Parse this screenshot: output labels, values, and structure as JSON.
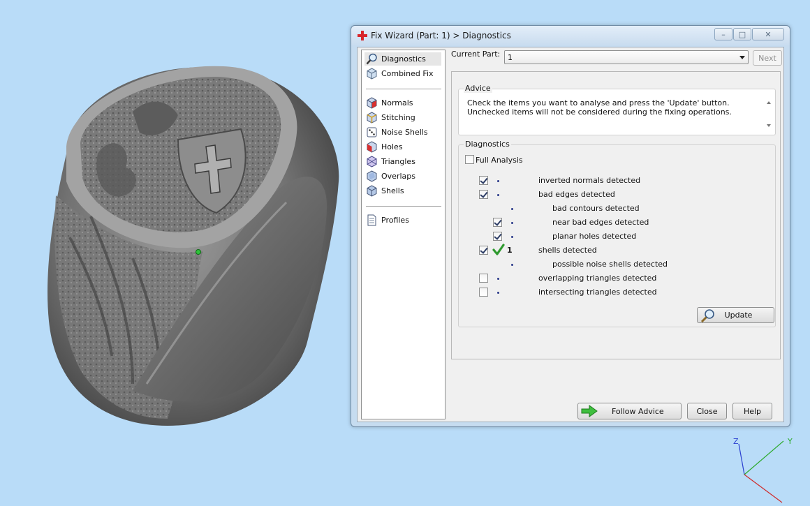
{
  "window": {
    "title": "Fix Wizard (Part: 1) > Diagnostics",
    "minimize_glyph": "–",
    "maximize_glyph": "□",
    "close_glyph": "✕"
  },
  "nav": {
    "top_items": [
      {
        "label": "Diagnostics",
        "icon": "magnifier-icon",
        "selected": true
      },
      {
        "label": "Combined Fix",
        "icon": "cube-icon"
      }
    ],
    "fix_items": [
      {
        "label": "Normals",
        "icon": "cube-red-face-icon"
      },
      {
        "label": "Stitching",
        "icon": "cube-stitch-icon"
      },
      {
        "label": "Noise Shells",
        "icon": "dice-icon"
      },
      {
        "label": "Holes",
        "icon": "cube-hole-icon"
      },
      {
        "label": "Triangles",
        "icon": "triangle-cube-icon"
      },
      {
        "label": "Overlaps",
        "icon": "overlap-cube-icon"
      },
      {
        "label": "Shells",
        "icon": "shells-cube-icon"
      }
    ],
    "profile_items": [
      {
        "label": "Profiles",
        "icon": "document-icon"
      }
    ]
  },
  "top_row": {
    "current_part_label": "Current Part:",
    "current_part_value": "1",
    "next_label": "Next"
  },
  "advice": {
    "title": "Advice",
    "text": "Check the items you want to analyse and press the 'Update' button. Unchecked items will not be considered during the fixing operations."
  },
  "diagnostics": {
    "title": "Diagnostics",
    "full_analysis_label": "Full Analysis",
    "full_analysis_checked": false,
    "rows": [
      {
        "label": "inverted normals detected",
        "checked": true,
        "level": 0,
        "count": ""
      },
      {
        "label": "bad edges detected",
        "checked": true,
        "level": 0,
        "count": ""
      },
      {
        "label": "bad contours detected",
        "checked": null,
        "level": 1,
        "count": ""
      },
      {
        "label": "near bad edges detected",
        "checked": true,
        "level": 1,
        "count": ""
      },
      {
        "label": "planar holes detected",
        "checked": true,
        "level": 1,
        "count": ""
      },
      {
        "label": "shells detected",
        "checked": true,
        "level": 0,
        "count": "1",
        "status": "ok"
      },
      {
        "label": "possible noise shells detected",
        "checked": null,
        "level": 1,
        "count": ""
      },
      {
        "label": "overlapping triangles detected",
        "checked": false,
        "level": 0,
        "count": ""
      },
      {
        "label": "intersecting triangles detected",
        "checked": false,
        "level": 0,
        "count": ""
      }
    ],
    "update_label": "Update"
  },
  "buttons": {
    "follow_advice": "Follow Advice",
    "close": "Close",
    "help": "Help"
  },
  "axes": {
    "z": "Z",
    "y": "Y"
  },
  "colors": {
    "desktop": "#b9dcf8",
    "accent_green": "#2f9a2f",
    "ring_gray": "#7c7c7c"
  }
}
